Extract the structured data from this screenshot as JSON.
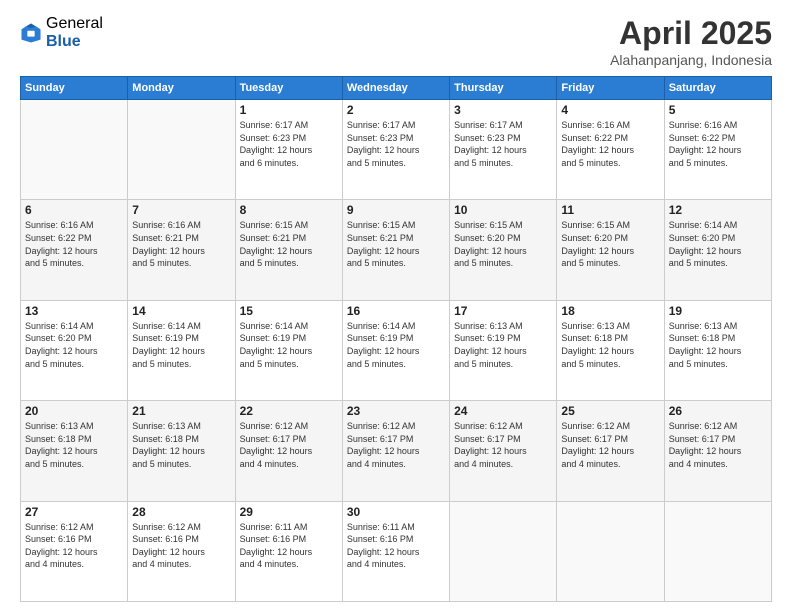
{
  "logo": {
    "general": "General",
    "blue": "Blue"
  },
  "title": "April 2025",
  "subtitle": "Alahanpanjang, Indonesia",
  "headers": [
    "Sunday",
    "Monday",
    "Tuesday",
    "Wednesday",
    "Thursday",
    "Friday",
    "Saturday"
  ],
  "weeks": [
    [
      {
        "day": "",
        "info": ""
      },
      {
        "day": "",
        "info": ""
      },
      {
        "day": "1",
        "info": "Sunrise: 6:17 AM\nSunset: 6:23 PM\nDaylight: 12 hours\nand 6 minutes."
      },
      {
        "day": "2",
        "info": "Sunrise: 6:17 AM\nSunset: 6:23 PM\nDaylight: 12 hours\nand 5 minutes."
      },
      {
        "day": "3",
        "info": "Sunrise: 6:17 AM\nSunset: 6:23 PM\nDaylight: 12 hours\nand 5 minutes."
      },
      {
        "day": "4",
        "info": "Sunrise: 6:16 AM\nSunset: 6:22 PM\nDaylight: 12 hours\nand 5 minutes."
      },
      {
        "day": "5",
        "info": "Sunrise: 6:16 AM\nSunset: 6:22 PM\nDaylight: 12 hours\nand 5 minutes."
      }
    ],
    [
      {
        "day": "6",
        "info": "Sunrise: 6:16 AM\nSunset: 6:22 PM\nDaylight: 12 hours\nand 5 minutes."
      },
      {
        "day": "7",
        "info": "Sunrise: 6:16 AM\nSunset: 6:21 PM\nDaylight: 12 hours\nand 5 minutes."
      },
      {
        "day": "8",
        "info": "Sunrise: 6:15 AM\nSunset: 6:21 PM\nDaylight: 12 hours\nand 5 minutes."
      },
      {
        "day": "9",
        "info": "Sunrise: 6:15 AM\nSunset: 6:21 PM\nDaylight: 12 hours\nand 5 minutes."
      },
      {
        "day": "10",
        "info": "Sunrise: 6:15 AM\nSunset: 6:20 PM\nDaylight: 12 hours\nand 5 minutes."
      },
      {
        "day": "11",
        "info": "Sunrise: 6:15 AM\nSunset: 6:20 PM\nDaylight: 12 hours\nand 5 minutes."
      },
      {
        "day": "12",
        "info": "Sunrise: 6:14 AM\nSunset: 6:20 PM\nDaylight: 12 hours\nand 5 minutes."
      }
    ],
    [
      {
        "day": "13",
        "info": "Sunrise: 6:14 AM\nSunset: 6:20 PM\nDaylight: 12 hours\nand 5 minutes."
      },
      {
        "day": "14",
        "info": "Sunrise: 6:14 AM\nSunset: 6:19 PM\nDaylight: 12 hours\nand 5 minutes."
      },
      {
        "day": "15",
        "info": "Sunrise: 6:14 AM\nSunset: 6:19 PM\nDaylight: 12 hours\nand 5 minutes."
      },
      {
        "day": "16",
        "info": "Sunrise: 6:14 AM\nSunset: 6:19 PM\nDaylight: 12 hours\nand 5 minutes."
      },
      {
        "day": "17",
        "info": "Sunrise: 6:13 AM\nSunset: 6:19 PM\nDaylight: 12 hours\nand 5 minutes."
      },
      {
        "day": "18",
        "info": "Sunrise: 6:13 AM\nSunset: 6:18 PM\nDaylight: 12 hours\nand 5 minutes."
      },
      {
        "day": "19",
        "info": "Sunrise: 6:13 AM\nSunset: 6:18 PM\nDaylight: 12 hours\nand 5 minutes."
      }
    ],
    [
      {
        "day": "20",
        "info": "Sunrise: 6:13 AM\nSunset: 6:18 PM\nDaylight: 12 hours\nand 5 minutes."
      },
      {
        "day": "21",
        "info": "Sunrise: 6:13 AM\nSunset: 6:18 PM\nDaylight: 12 hours\nand 5 minutes."
      },
      {
        "day": "22",
        "info": "Sunrise: 6:12 AM\nSunset: 6:17 PM\nDaylight: 12 hours\nand 4 minutes."
      },
      {
        "day": "23",
        "info": "Sunrise: 6:12 AM\nSunset: 6:17 PM\nDaylight: 12 hours\nand 4 minutes."
      },
      {
        "day": "24",
        "info": "Sunrise: 6:12 AM\nSunset: 6:17 PM\nDaylight: 12 hours\nand 4 minutes."
      },
      {
        "day": "25",
        "info": "Sunrise: 6:12 AM\nSunset: 6:17 PM\nDaylight: 12 hours\nand 4 minutes."
      },
      {
        "day": "26",
        "info": "Sunrise: 6:12 AM\nSunset: 6:17 PM\nDaylight: 12 hours\nand 4 minutes."
      }
    ],
    [
      {
        "day": "27",
        "info": "Sunrise: 6:12 AM\nSunset: 6:16 PM\nDaylight: 12 hours\nand 4 minutes."
      },
      {
        "day": "28",
        "info": "Sunrise: 6:12 AM\nSunset: 6:16 PM\nDaylight: 12 hours\nand 4 minutes."
      },
      {
        "day": "29",
        "info": "Sunrise: 6:11 AM\nSunset: 6:16 PM\nDaylight: 12 hours\nand 4 minutes."
      },
      {
        "day": "30",
        "info": "Sunrise: 6:11 AM\nSunset: 6:16 PM\nDaylight: 12 hours\nand 4 minutes."
      },
      {
        "day": "",
        "info": ""
      },
      {
        "day": "",
        "info": ""
      },
      {
        "day": "",
        "info": ""
      }
    ]
  ]
}
